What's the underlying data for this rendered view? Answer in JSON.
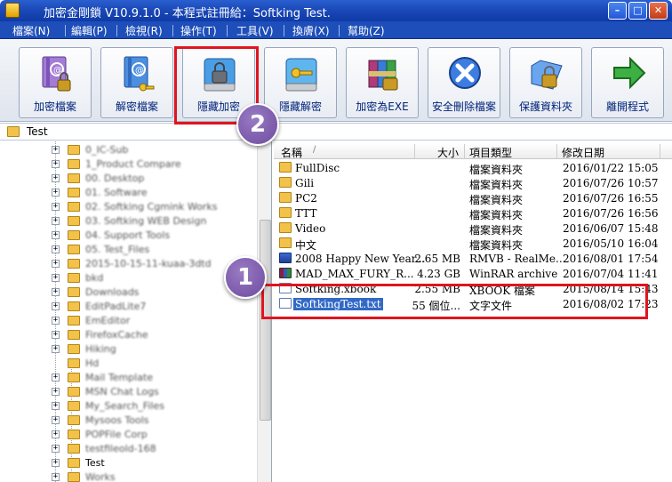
{
  "window": {
    "title": "加密金剛鎖 V10.9.1.0 - 本程式註冊給：Softking Test.",
    "buttons": {
      "minimize": "–",
      "maximize": "□",
      "close": "✕"
    }
  },
  "menu": [
    {
      "label": "檔案(N)"
    },
    {
      "label": "編輯(P)"
    },
    {
      "label": "檢視(R)"
    },
    {
      "label": "操作(T)"
    },
    {
      "label": "工具(V)"
    },
    {
      "label": "換膚(X)"
    },
    {
      "label": "幫助(Z)"
    }
  ],
  "toolbar": [
    {
      "label": "加密檔案",
      "icon": "encrypt-file-icon"
    },
    {
      "label": "解密檔案",
      "icon": "decrypt-file-icon"
    },
    {
      "label": "隱藏加密",
      "icon": "hide-encrypt-icon"
    },
    {
      "label": "隱藏解密",
      "icon": "hide-decrypt-icon"
    },
    {
      "label": "加密為EXE",
      "icon": "encrypt-exe-icon"
    },
    {
      "label": "安全刪除檔案",
      "icon": "secure-delete-icon"
    },
    {
      "label": "保護資料夾",
      "icon": "protect-folder-icon"
    },
    {
      "label": "離開程式",
      "icon": "exit-icon"
    }
  ],
  "path": {
    "text": "Test"
  },
  "tree": [
    {
      "label": "0_IC-Sub",
      "blurred": true
    },
    {
      "label": "1_Product Compare",
      "blurred": true
    },
    {
      "label": "00. Desktop",
      "blurred": true
    },
    {
      "label": "01. Software",
      "blurred": true
    },
    {
      "label": "02. Softking Cgmink Works",
      "blurred": true
    },
    {
      "label": "03. Softking WEB Design",
      "blurred": true
    },
    {
      "label": "04. Support Tools",
      "blurred": true
    },
    {
      "label": "05. Test_Files",
      "blurred": true
    },
    {
      "label": "2015-10-15-11-kuaa-3dtd",
      "blurred": true
    },
    {
      "label": "bkd",
      "blurred": true
    },
    {
      "label": "Downloads",
      "blurred": true
    },
    {
      "label": "EditPadLite7",
      "blurred": true
    },
    {
      "label": "EmEditor",
      "blurred": true
    },
    {
      "label": "FirefoxCache",
      "blurred": true
    },
    {
      "label": "Hiking",
      "blurred": true
    },
    {
      "label": "Hd",
      "blurred": true
    },
    {
      "label": "Mail Template",
      "blurred": true
    },
    {
      "label": "MSN Chat Logs",
      "blurred": true
    },
    {
      "label": "My_Search_Files",
      "blurred": true
    },
    {
      "label": "Mysoos Tools",
      "blurred": true
    },
    {
      "label": "POPFile Corp",
      "blurred": true
    },
    {
      "label": "testfileold-168",
      "blurred": true
    },
    {
      "label": "Test",
      "blurred": false
    },
    {
      "label": "Works",
      "blurred": true
    }
  ],
  "list": {
    "columns": {
      "name": "名稱",
      "size": "大小",
      "type": "項目類型",
      "date": "修改日期"
    },
    "rows": [
      {
        "name": "FullDisc",
        "size": "",
        "type": "檔案資料夾",
        "date": "2016/01/22 15:05",
        "icon": "folder"
      },
      {
        "name": "Gili",
        "size": "",
        "type": "檔案資料夾",
        "date": "2016/07/26 10:57",
        "icon": "folder"
      },
      {
        "name": "PC2",
        "size": "",
        "type": "檔案資料夾",
        "date": "2016/07/26 16:55",
        "icon": "folder"
      },
      {
        "name": "TTT",
        "size": "",
        "type": "檔案資料夾",
        "date": "2016/07/26 16:56",
        "icon": "folder"
      },
      {
        "name": "Video",
        "size": "",
        "type": "檔案資料夾",
        "date": "2016/06/07 15:48",
        "icon": "folder"
      },
      {
        "name": "中文",
        "size": "",
        "type": "檔案資料夾",
        "date": "2016/05/10 16:04",
        "icon": "folder"
      },
      {
        "name": "2008 Happy New Year...",
        "size": "2.65 MB",
        "type": "RMVB - RealMe...",
        "date": "2016/08/01 17:54",
        "icon": "media"
      },
      {
        "name": "MAD_MAX_FURY_R...",
        "size": "4.23 GB",
        "type": "WinRAR archive",
        "date": "2016/07/04 11:41",
        "icon": "rar"
      },
      {
        "name": "Softking.xbook",
        "size": "2.55 MB",
        "type": "XBOOK 檔案",
        "date": "2015/08/14 15:43",
        "icon": "doc"
      },
      {
        "name": "SoftkingTest.txt",
        "size": "55 個位...",
        "type": "文字文件",
        "date": "2016/08/02 17:23",
        "icon": "txt",
        "selected": true
      }
    ]
  },
  "annotations": [
    {
      "label": "1"
    },
    {
      "label": "2"
    }
  ],
  "colors": {
    "highlight": "#e0141e",
    "badge": "#7a58ab",
    "selection": "#3169c6",
    "titlebar": "#1d4eb9"
  }
}
